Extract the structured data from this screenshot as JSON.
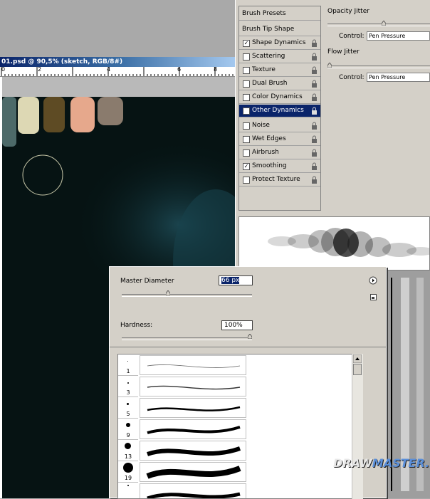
{
  "document": {
    "title": "01.psd @ 90,5% (sketch, RGB/8#)",
    "ruler_labels": [
      "0",
      "2",
      "4",
      "6",
      "8"
    ]
  },
  "brushes": {
    "items": [
      {
        "label": "Brush Presets",
        "checkbox": false
      },
      {
        "label": "Brush Tip Shape",
        "checkbox": false
      },
      {
        "label": "Shape Dynamics",
        "checkbox": true,
        "checked": true
      },
      {
        "label": "Scattering",
        "checkbox": true,
        "checked": false
      },
      {
        "label": "Texture",
        "checkbox": true,
        "checked": false
      },
      {
        "label": "Dual Brush",
        "checkbox": true,
        "checked": false
      },
      {
        "label": "Color Dynamics",
        "checkbox": true,
        "checked": false
      },
      {
        "label": "Other Dynamics",
        "checkbox": true,
        "checked": true,
        "selected": true
      },
      {
        "label": "Noise",
        "checkbox": true,
        "checked": false
      },
      {
        "label": "Wet Edges",
        "checkbox": true,
        "checked": false
      },
      {
        "label": "Airbrush",
        "checkbox": true,
        "checked": false
      },
      {
        "label": "Smoothing",
        "checkbox": true,
        "checked": true
      },
      {
        "label": "Protect Texture",
        "checkbox": true,
        "checked": false
      }
    ],
    "opacity_jitter_label": "Opacity Jitter",
    "opacity_jitter_value": 0.55,
    "control_label": "Control:",
    "opacity_control": "Pen Pressure",
    "flow_jitter_label": "Flow Jitter",
    "flow_jitter_value": 0.0,
    "flow_control": "Pen Pressure"
  },
  "popup": {
    "master_diameter_label": "Master Diameter",
    "master_diameter_value": "66 px",
    "master_diameter_slider": 0.35,
    "hardness_label": "Hardness:",
    "hardness_value": "100%",
    "hardness_slider": 1.0,
    "tips": [
      {
        "size": "1"
      },
      {
        "size": "3"
      },
      {
        "size": "5"
      },
      {
        "size": "9"
      },
      {
        "size": "13"
      },
      {
        "size": "19"
      }
    ]
  },
  "watermark": {
    "prefix": "DRAW",
    "suffix": "MASTER.RU"
  },
  "colors": {
    "selection": "#0a246a",
    "panel": "#d4d0c8",
    "canvas": "#061313"
  }
}
